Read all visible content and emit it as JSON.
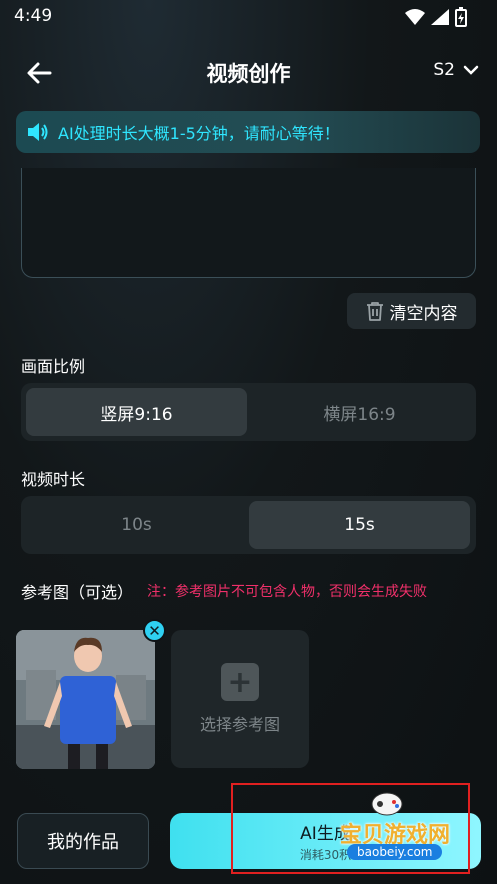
{
  "status_bar": {
    "time": "4:49",
    "wifi_icon": "wifi-icon",
    "signal_icon": "signal-icon",
    "battery_icon": "battery-charging-icon"
  },
  "header": {
    "title": "视频创作",
    "back_icon": "arrow-left-icon",
    "version": "S2",
    "version_icon": "chevron-down-icon"
  },
  "notice": {
    "icon": "speaker-icon",
    "text": "AI处理时长大概1-5分钟，请耐心等待！"
  },
  "prompt": {
    "value": ""
  },
  "clear_button": {
    "label": "清空内容",
    "icon": "trash-icon"
  },
  "aspect_ratio": {
    "label": "画面比例",
    "options": [
      {
        "label": "竖屏9:16",
        "selected": true
      },
      {
        "label": "横屏16:9",
        "selected": false
      }
    ]
  },
  "duration": {
    "label": "视频时长",
    "options": [
      {
        "label": "10s",
        "selected": false
      },
      {
        "label": "15s",
        "selected": true
      }
    ]
  },
  "reference": {
    "label": "参考图（可选）",
    "note": "注：参考图片不可包含人物，否则会生成失败",
    "add_label": "选择参考图",
    "add_icon": "plus-icon",
    "remove_icon": "close-icon"
  },
  "footer": {
    "my_works_label": "我的作品",
    "generate_label": "AI生成",
    "generate_cost": "消耗30积"
  },
  "watermark": {
    "text": "宝贝游戏网",
    "url": "baobeiy.com"
  },
  "colors": {
    "accent": "#2fe6ff",
    "warning": "#f0306a",
    "background": "#0f1316",
    "button_gradient_start": "#3fe0ef"
  }
}
